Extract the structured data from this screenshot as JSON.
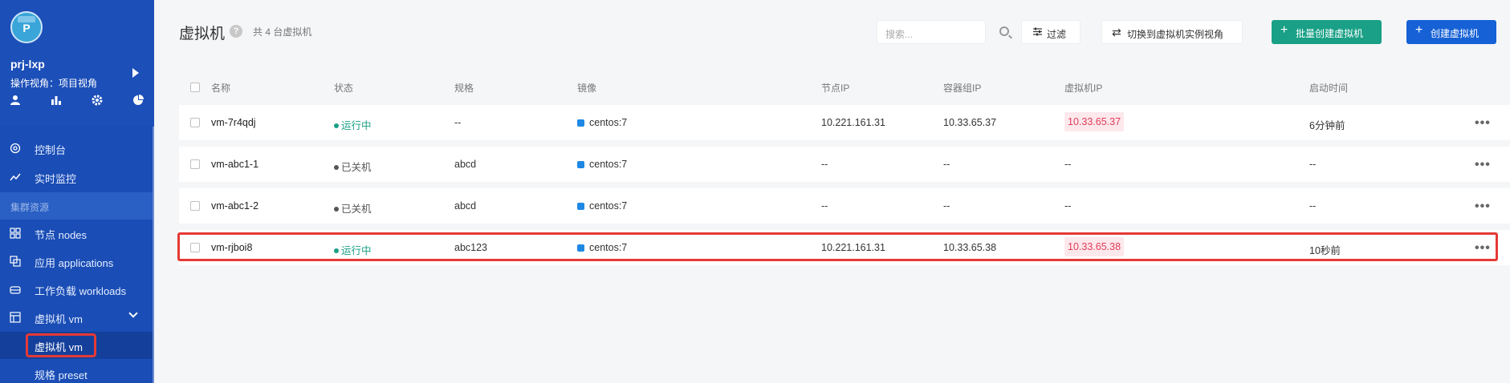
{
  "sidebar": {
    "avatar_letter": "P",
    "project_name": "prj-lxp",
    "view_label": "操作视角：项目视角",
    "section_header": "集群资源",
    "items": [
      {
        "label": "控制台"
      },
      {
        "label": "实时监控"
      },
      {
        "label": "节点 nodes"
      },
      {
        "label": "应用 applications"
      },
      {
        "label": "工作负载 workloads"
      },
      {
        "label": "虚拟机 vm"
      },
      {
        "label": "虚拟机 vm"
      },
      {
        "label": "规格 preset"
      }
    ]
  },
  "header": {
    "title": "虚拟机",
    "help": "?",
    "count": "共 4 台虚拟机",
    "search_placeholder": "搜索...",
    "filter_label": "过滤",
    "switch_label": "切换到虚拟机实例视角",
    "batch_create_label": "批量创建虚拟机",
    "create_label": "创建虚拟机"
  },
  "table": {
    "columns": {
      "name": "名称",
      "status": "状态",
      "spec": "规格",
      "image": "镜像",
      "node_ip": "节点IP",
      "pod_ip": "容器组IP",
      "vm_ip": "虚拟机IP",
      "start_time": "启动时间"
    },
    "rows": [
      {
        "name": "vm-7r4qdj",
        "status": "运行中",
        "spec": "--",
        "image": "centos:7",
        "node_ip": "10.221.161.31",
        "pod_ip": "10.33.65.37",
        "vm_ip": "10.33.65.37",
        "start_time": "6分钟前"
      },
      {
        "name": "vm-abc1-1",
        "status": "已关机",
        "spec": "abcd",
        "image": "centos:7",
        "node_ip": "--",
        "pod_ip": "--",
        "vm_ip": "--",
        "start_time": "--"
      },
      {
        "name": "vm-abc1-2",
        "status": "已关机",
        "spec": "abcd",
        "image": "centos:7",
        "node_ip": "--",
        "pod_ip": "--",
        "vm_ip": "--",
        "start_time": "--"
      },
      {
        "name": "vm-rjboi8",
        "status": "运行中",
        "spec": "abc123",
        "image": "centos:7",
        "node_ip": "10.221.161.31",
        "pod_ip": "10.33.65.38",
        "vm_ip": "10.33.65.38",
        "start_time": "10秒前"
      }
    ],
    "more": "•••"
  },
  "colors": {
    "sidebar_bg": "#1c4fb8",
    "running": "#19a086",
    "stopped": "#555555",
    "ip_tag_text": "#e03c5a",
    "primary": "#1661d6",
    "highlight": "#e53935"
  }
}
